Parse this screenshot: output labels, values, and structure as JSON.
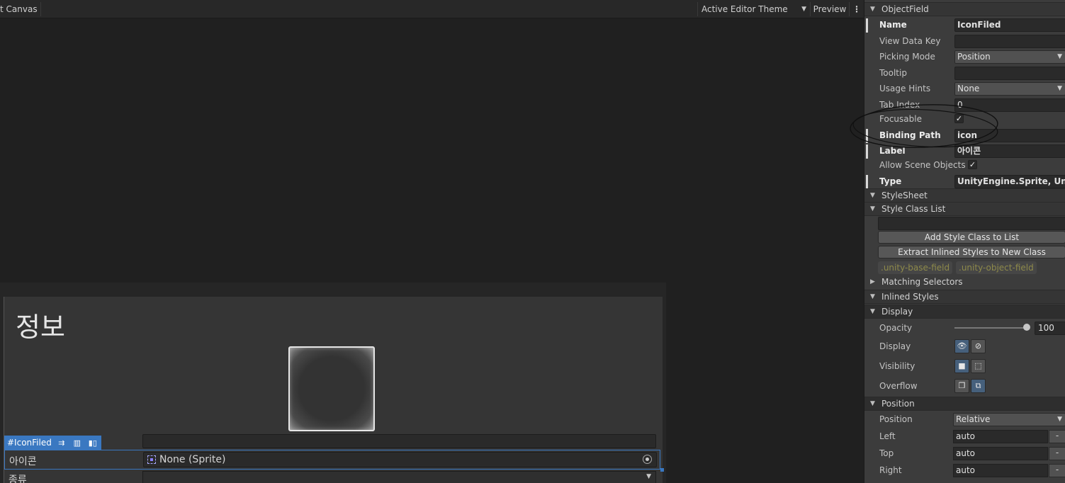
{
  "toolbar": {
    "canvas_title": "t Canvas",
    "theme": "Active Editor Theme",
    "preview": "Preview",
    "more": "⋮"
  },
  "canvas": {
    "title": "정보",
    "selection_tag": "#IconFiled",
    "icon_field_label": "아이콘",
    "icon_field_value": "None (Sprite)",
    "kind_label": "종류"
  },
  "inspector": {
    "object_field_header": "ObjectField",
    "props": {
      "name": {
        "label": "Name",
        "value": "IconFiled"
      },
      "view_data_key": {
        "label": "View Data Key",
        "value": ""
      },
      "picking_mode": {
        "label": "Picking Mode",
        "value": "Position"
      },
      "tooltip": {
        "label": "Tooltip",
        "value": ""
      },
      "usage_hints": {
        "label": "Usage Hints",
        "value": "None"
      },
      "tab_index": {
        "label": "Tab Index",
        "value": "0"
      },
      "focusable": {
        "label": "Focusable",
        "checked": true
      },
      "binding_path": {
        "label": "Binding Path",
        "value": "icon"
      },
      "label": {
        "label": "Label",
        "value": "아이콘"
      },
      "allow_scene_objects": {
        "label": "Allow Scene Objects",
        "checked": true
      },
      "type": {
        "label": "Type",
        "value": "UnityEngine.Sprite, UnityE"
      }
    },
    "stylesheet_header": "StyleSheet",
    "style_class_list_header": "Style Class List",
    "add_style_class_button": "Add Style Class to List",
    "extract_styles_button": "Extract Inlined Styles to New Class",
    "classes": [
      ".unity-base-field",
      ".unity-object-field"
    ],
    "matching_selectors": "Matching Selectors",
    "inlined_styles_header": "Inlined Styles",
    "display_header": "Display",
    "opacity": {
      "label": "Opacity",
      "value": "100"
    },
    "display_label": "Display",
    "visibility_label": "Visibility",
    "overflow_label": "Overflow",
    "position_header": "Position",
    "position": {
      "label": "Position",
      "value": "Relative"
    },
    "left": {
      "label": "Left",
      "value": "auto"
    },
    "top": {
      "label": "Top",
      "value": "auto"
    },
    "right": {
      "label": "Right",
      "value": "auto"
    }
  }
}
